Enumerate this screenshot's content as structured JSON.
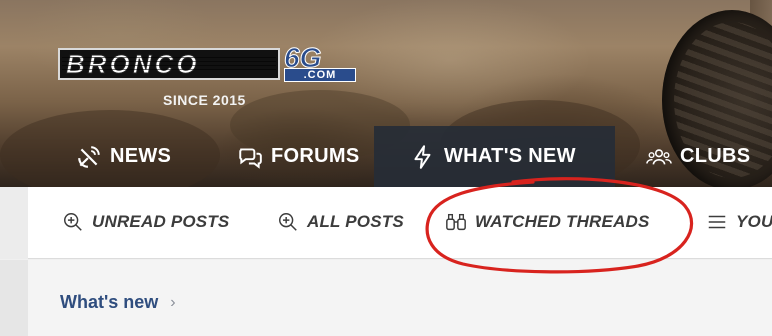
{
  "header": {
    "logo_text": "BRONCO",
    "logo_suffix": "6G",
    "logo_domain": ".COM",
    "tagline": "SINCE 2015"
  },
  "main_nav": {
    "items": [
      {
        "label": "NEWS",
        "icon": "satellite-dish-icon"
      },
      {
        "label": "FORUMS",
        "icon": "chat-bubbles-icon"
      },
      {
        "label": "WHAT'S NEW",
        "icon": "lightning-bolt-icon",
        "active": true
      },
      {
        "label": "CLUBS",
        "icon": "users-group-icon"
      }
    ]
  },
  "sub_nav": {
    "items": [
      {
        "label": "UNREAD POSTS",
        "icon": "magnifier-plus-icon"
      },
      {
        "label": "ALL POSTS",
        "icon": "magnifier-plus-icon"
      },
      {
        "label": "WATCHED THREADS",
        "icon": "binoculars-icon",
        "highlighted": true
      },
      {
        "label": "YOU",
        "icon": "menu-lines-icon"
      }
    ]
  },
  "breadcrumb": {
    "label": "What's new",
    "chevron": "›"
  },
  "colors": {
    "annotation_red": "#d8231e",
    "link_blue": "#2f4d7e",
    "nav_active_bg": "#262c36"
  }
}
